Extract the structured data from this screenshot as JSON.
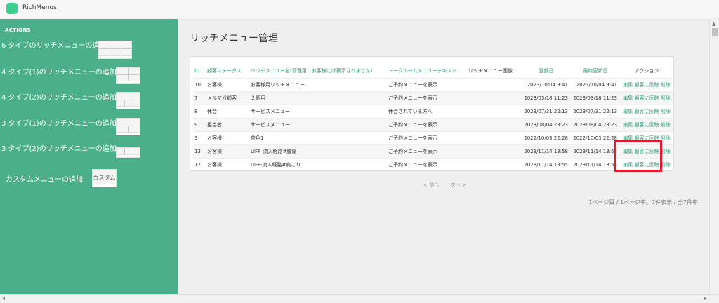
{
  "app": {
    "title": "RichMenus"
  },
  "sidebar": {
    "heading": "ACTIONS",
    "items": [
      {
        "label": "6 タイプのリッチメニューの追加"
      },
      {
        "label": "4 タイプ(1)のリッチメニューの追加"
      },
      {
        "label": "4 タイプ(2)のリッチメニューの追加"
      },
      {
        "label": "3 タイプ(1)のリッチメニューの追加"
      },
      {
        "label": "3 タイプ(2)のリッチメニューの追加"
      },
      {
        "label": "カスタムメニューの追加",
        "thumb_text": "カスタム"
      }
    ]
  },
  "main": {
    "title": "リッチメニュー管理",
    "table": {
      "headers": {
        "id": "ID",
        "status": "顧客ステータス",
        "name": "リッチメニュー名(管理用：お客様には表示されません)",
        "talk": "トークルームメニューテキスト",
        "image": "リッチメニュー画像",
        "created": "登録日",
        "updated": "最終更新日",
        "actions": "アクション"
      },
      "action_labels": {
        "edit": "編集",
        "apply": "顧客に反映",
        "delete": "削除"
      },
      "rows": [
        {
          "id": "10",
          "status": "お客様",
          "name": "お客様用リッチメニュー",
          "talk": "ご予約メニューを表示",
          "created": "2023/10/04 9:41",
          "updated": "2023/10/04 9:41"
        },
        {
          "id": "7",
          "status": "メルマガ顧客",
          "name": "２個用",
          "talk": "ご予約メニューを表示",
          "created": "2023/03/18 11:23",
          "updated": "2023/03/18 11:23"
        },
        {
          "id": "8",
          "status": "休会",
          "name": "サービスメニュー",
          "talk": "休会されている方へ",
          "created": "2023/07/31 22:13",
          "updated": "2023/07/31 22:13"
        },
        {
          "id": "9",
          "status": "担当者",
          "name": "サービスメニュー",
          "talk": "ご予約メニューを表示",
          "created": "2023/08/04 23:23",
          "updated": "2023/08/04 23:23"
        },
        {
          "id": "3",
          "status": "お客様",
          "name": "茶色1",
          "talk": "ご予約メニューを表示",
          "created": "2022/10/03 22:28",
          "updated": "2022/10/03 22:28"
        },
        {
          "id": "13",
          "status": "お客様",
          "name": "LIFF_流入経路#腰痛",
          "talk": "ご予約メニューを表示",
          "created": "2023/11/14 13:58",
          "updated": "2023/11/14 13:58"
        },
        {
          "id": "12",
          "status": "お客様",
          "name": "LIFF-流入経路#肩こり",
          "talk": "ご予約メニューを表示",
          "created": "2023/11/14 13:55",
          "updated": "2023/11/14 13:55"
        }
      ]
    },
    "pager": {
      "prev": "< 前へ",
      "next": "次へ >"
    },
    "summary": "1ページ目 / 1ページ中。7件表示 / 全7件中"
  },
  "colors": {
    "sidebar": "#4caf8c",
    "accent": "#2f9e7a",
    "highlight": "#e11b2b"
  }
}
